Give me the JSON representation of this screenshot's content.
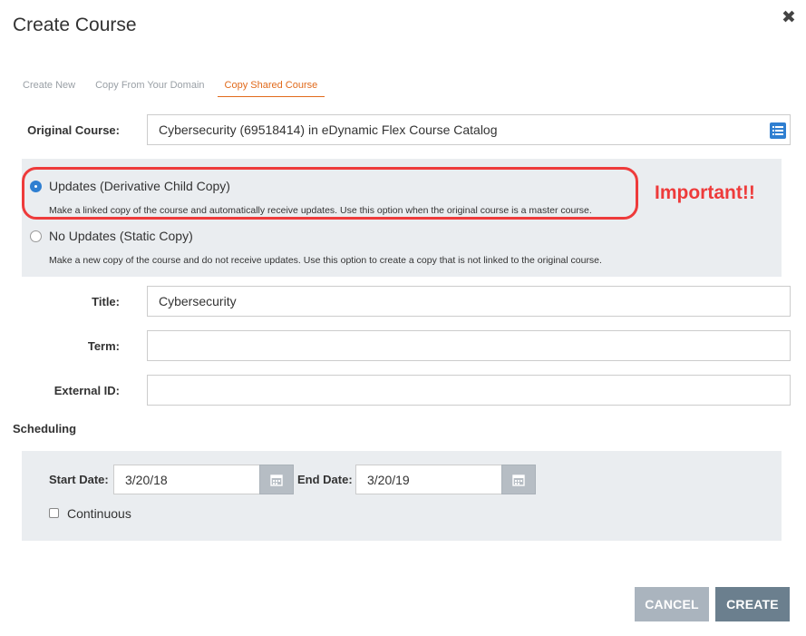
{
  "dialog": {
    "title": "Create Course",
    "close_glyph": "✖"
  },
  "tabs": [
    {
      "label": "Create New",
      "active": false
    },
    {
      "label": "Copy From Your Domain",
      "active": false
    },
    {
      "label": "Copy Shared Course",
      "active": true
    }
  ],
  "original_course": {
    "label": "Original Course:",
    "value": "Cybersecurity (69518414) in eDynamic Flex Course Catalog",
    "browse_icon": "list-icon"
  },
  "copy_options": [
    {
      "label": "Updates (Derivative Child Copy)",
      "description": "Make a linked copy of the course and automatically receive updates. Use this option when the original course is a master course.",
      "selected": true
    },
    {
      "label": "No Updates (Static Copy)",
      "description": "Make a new copy of the course and do not receive updates. Use this option to create a copy that is not linked to the original course.",
      "selected": false
    }
  ],
  "annotation": {
    "text": "Important!!",
    "color": "#ee3b3b"
  },
  "fields": {
    "title": {
      "label": "Title:",
      "value": "Cybersecurity"
    },
    "term": {
      "label": "Term:",
      "value": ""
    },
    "external_id": {
      "label": "External ID:",
      "value": ""
    }
  },
  "scheduling": {
    "section_label": "Scheduling",
    "start_date": {
      "label": "Start Date:",
      "value": "3/20/18"
    },
    "end_date": {
      "label": "End Date:",
      "value": "3/20/19"
    },
    "continuous": {
      "label": "Continuous",
      "checked": false
    }
  },
  "actions": {
    "cancel_label": "CANCEL",
    "create_label": "CREATE"
  },
  "colors": {
    "accent_tab": "#e16a1b",
    "radio_selected": "#2f7fd1",
    "panel_bg": "#eaedf0",
    "cancel_bg": "#aab4be",
    "create_bg": "#6b7f8e"
  }
}
